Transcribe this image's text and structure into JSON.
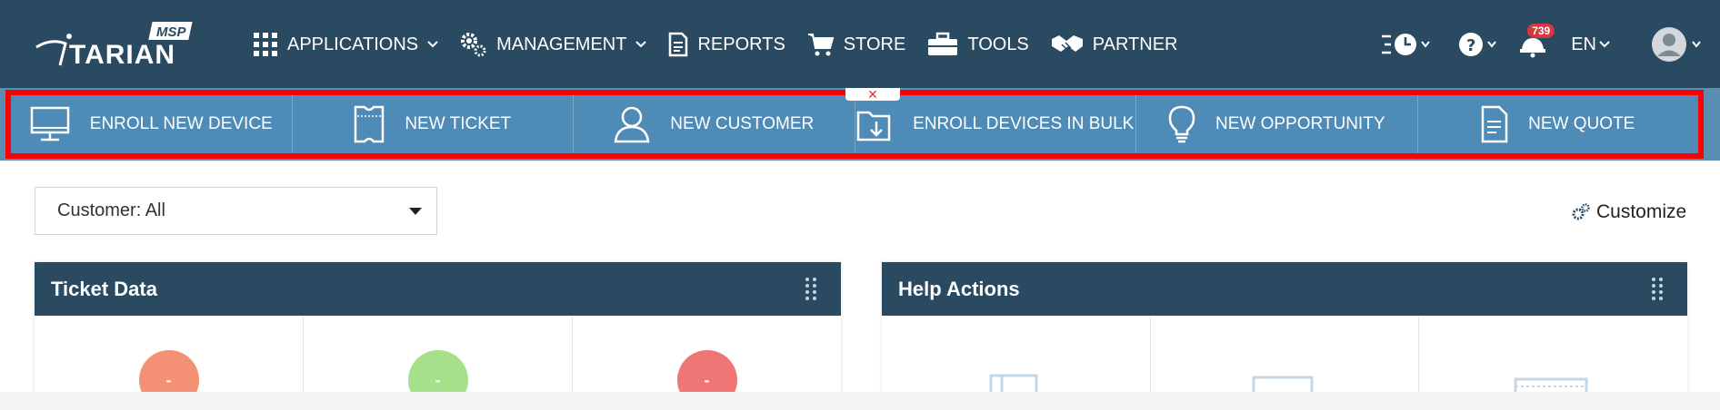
{
  "brand": {
    "logo_text": "TARIAN",
    "logo_badge": "MSP"
  },
  "topnav": {
    "items": [
      {
        "label": "APPLICATIONS",
        "icon": "grid-icon",
        "has_caret": true
      },
      {
        "label": "MANAGEMENT",
        "icon": "gears-icon",
        "has_caret": true
      },
      {
        "label": "REPORTS",
        "icon": "document-icon",
        "has_caret": false
      },
      {
        "label": "STORE",
        "icon": "cart-icon",
        "has_caret": false
      },
      {
        "label": "TOOLS",
        "icon": "toolbox-icon",
        "has_caret": false
      },
      {
        "label": "PARTNER",
        "icon": "handshake-icon",
        "has_caret": false
      }
    ],
    "right": {
      "notifications_count": "739",
      "language": "EN"
    }
  },
  "quick_actions": [
    {
      "label": "ENROLL NEW DEVICE",
      "icon": "monitor-icon"
    },
    {
      "label": "NEW TICKET",
      "icon": "ticket-icon"
    },
    {
      "label": "NEW CUSTOMER",
      "icon": "user-icon"
    },
    {
      "label": "ENROLL DEVICES IN BULK",
      "icon": "folder-download-icon"
    },
    {
      "label": "NEW OPPORTUNITY",
      "icon": "lightbulb-icon"
    },
    {
      "label": "NEW QUOTE",
      "icon": "quote-document-icon"
    }
  ],
  "filters": {
    "customer_select": "Customer: All"
  },
  "customize_label": "Customize",
  "widgets": {
    "ticket_data": {
      "title": "Ticket Data",
      "values": [
        "-",
        "-",
        "-"
      ],
      "colors": [
        "#f49074",
        "#a6e08a",
        "#f07676"
      ]
    },
    "help_actions": {
      "title": "Help Actions"
    }
  },
  "colors": {
    "nav_bg": "#2a4a62",
    "quickbar_bg": "#4e8bb6",
    "highlight": "#ff0000"
  }
}
